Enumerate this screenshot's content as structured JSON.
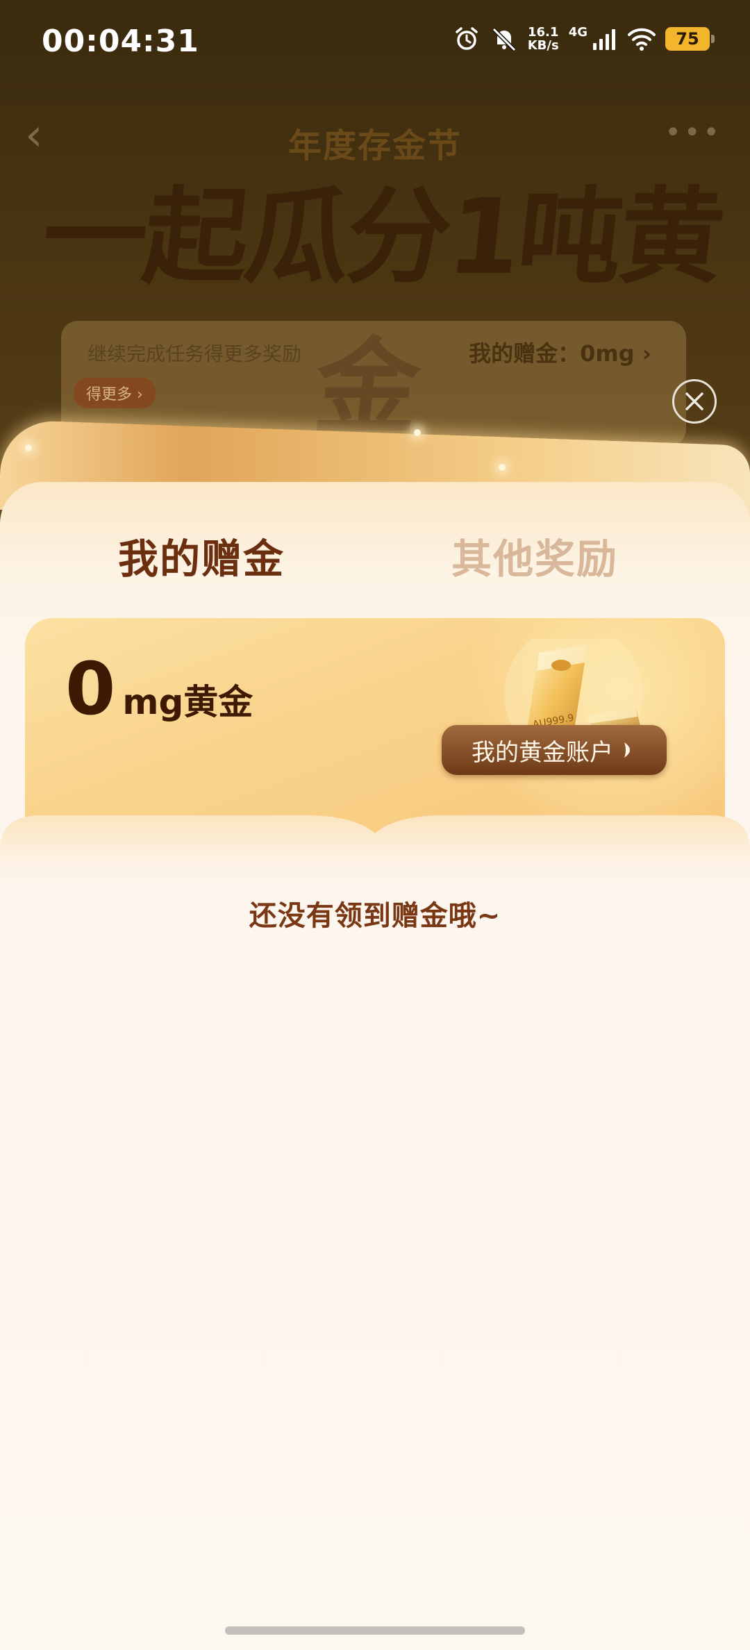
{
  "status_bar": {
    "time": "00:04:31",
    "net_speed_value": "16.1",
    "net_speed_unit": "KB/s",
    "network_type": "4G",
    "battery_level": "75"
  },
  "background_page": {
    "subtitle": "年度存金节",
    "title": "一起瓜分1吨黄金",
    "card_left_text": "继续完成任务得更多奖励",
    "card_right_text": "我的赠金：0mg ›",
    "card_pill_text": "得更多 ›"
  },
  "sheet": {
    "tabs": [
      {
        "label": "我的赠金",
        "active": true
      },
      {
        "label": "其他奖励",
        "active": false
      }
    ],
    "gold_card": {
      "amount": "0",
      "unit": "mg黄金",
      "bar_engraving": "AU999.9",
      "account_button_label": "我的黄金账户"
    },
    "empty_message": "还没有领到赠金哦~"
  },
  "colors": {
    "tab_active": "#6b2f10",
    "tab_inactive": "#d8b79a",
    "empty_text": "#7a3714",
    "battery": "#f2b52c"
  }
}
